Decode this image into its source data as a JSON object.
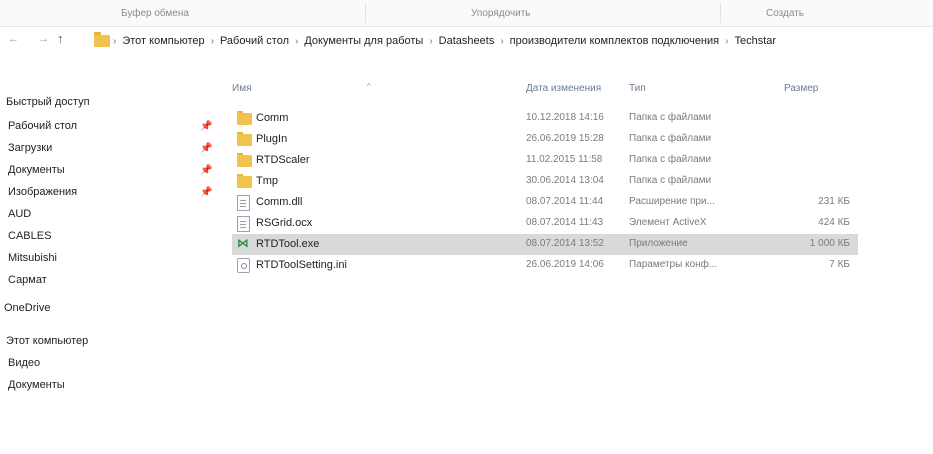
{
  "ribbon": {
    "groups": [
      "Буфер обмена",
      "Упорядочить",
      "Создать"
    ]
  },
  "addressbar": {
    "back": "←",
    "forward": "→",
    "up": "↑",
    "crumbs": [
      "Этот компьютер",
      "Рабочий стол",
      "Документы для работы",
      "Datasheets",
      "производители комплектов подключения",
      "Techstar"
    ],
    "separator": "›"
  },
  "navpane": {
    "items": [
      {
        "label": "Быстрый доступ",
        "pinned": false
      },
      {
        "label": "Рабочий стол",
        "pinned": true
      },
      {
        "label": "Загрузки",
        "pinned": true
      },
      {
        "label": "Документы",
        "pinned": true
      },
      {
        "label": "Изображения",
        "pinned": true
      },
      {
        "label": "AUD",
        "pinned": false
      },
      {
        "label": "CABLES",
        "pinned": false
      },
      {
        "label": "Mitsubishi",
        "pinned": false
      },
      {
        "label": "Сармат",
        "pinned": false
      },
      {
        "label": "OneDrive",
        "pinned": false
      },
      {
        "label": "Этот компьютер",
        "pinned": false
      },
      {
        "label": "Видео",
        "pinned": false
      },
      {
        "label": "Документы",
        "pinned": false
      }
    ],
    "pin_glyph": "📌"
  },
  "filelist": {
    "columns": {
      "name": "Имя",
      "date": "Дата изменения",
      "type": "Тип",
      "size": "Размер"
    },
    "files": [
      {
        "name": "Comm",
        "date": "10.12.2018 14:16",
        "type": "Папка с файлами",
        "size": "",
        "icon": "folder-icon"
      },
      {
        "name": "PlugIn",
        "date": "26.06.2019 15:28",
        "type": "Папка с файлами",
        "size": "",
        "icon": "folder-icon"
      },
      {
        "name": "RTDScaler",
        "date": "11.02.2015 11:58",
        "type": "Папка с файлами",
        "size": "",
        "icon": "folder-icon"
      },
      {
        "name": "Tmp",
        "date": "30.06.2014 13:04",
        "type": "Папка с файлами",
        "size": "",
        "icon": "folder-icon"
      },
      {
        "name": "Comm.dll",
        "date": "08.07.2014 11:44",
        "type": "Расширение при...",
        "size": "231 КБ",
        "icon": "dll-file-icon"
      },
      {
        "name": "RSGrid.ocx",
        "date": "08.07.2014 11:43",
        "type": "Элемент ActiveX",
        "size": "424 КБ",
        "icon": "ocx-file-icon"
      },
      {
        "name": "RTDTool.exe",
        "date": "08.07.2014 13:52",
        "type": "Приложение",
        "size": "1 000 КБ",
        "icon": "exe-app-icon",
        "selected": true
      },
      {
        "name": "RTDToolSetting.ini",
        "date": "26.06.2019 14:06",
        "type": "Параметры конф...",
        "size": "7 КБ",
        "icon": "ini-settings-icon"
      }
    ]
  },
  "colors": {
    "selection": "#d9d9d9",
    "folder": "#f2c24f",
    "header_text": "#6b7c93"
  }
}
